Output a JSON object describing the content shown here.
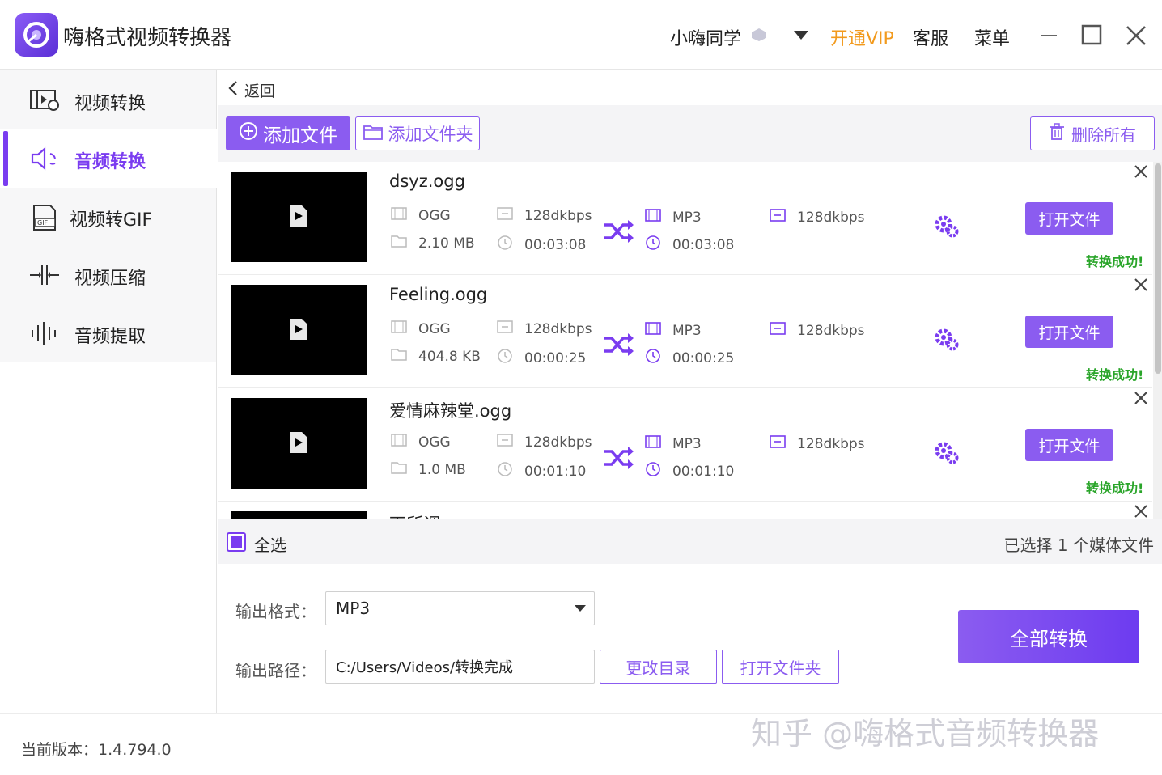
{
  "app": {
    "title": "嗨格式视频转换器"
  },
  "header": {
    "user_name": "小嗨同学",
    "vip": "开通VIP",
    "service": "客服",
    "menu": "菜单"
  },
  "sidebar": {
    "items": [
      {
        "label": "视频转换",
        "icon": "video-convert-icon",
        "active": false
      },
      {
        "label": "音频转换",
        "icon": "audio-convert-icon",
        "active": true
      },
      {
        "label": "视频转GIF",
        "icon": "gif-icon",
        "active": false
      },
      {
        "label": "视频压缩",
        "icon": "compress-icon",
        "active": false
      },
      {
        "label": "音频提取",
        "icon": "audio-extract-icon",
        "active": false
      }
    ],
    "version": "当前版本：1.4.794.0"
  },
  "main": {
    "back": "返回",
    "add_file": "添加文件",
    "add_folder": "添加文件夹",
    "delete_all": "删除所有",
    "files": [
      {
        "name": "dsyz.ogg",
        "src_format": "OGG",
        "src_bitrate": "128dkbps",
        "size": "2.10 MB",
        "src_duration": "00:03:08",
        "out_format": "MP3",
        "out_bitrate": "128dkbps",
        "out_duration": "00:03:08",
        "open": "打开文件",
        "status": "转换成功!"
      },
      {
        "name": "Feeling.ogg",
        "src_format": "OGG",
        "src_bitrate": "128dkbps",
        "size": "404.8 KB",
        "src_duration": "00:00:25",
        "out_format": "MP3",
        "out_bitrate": "128dkbps",
        "out_duration": "00:00:25",
        "open": "打开文件",
        "status": "转换成功!"
      },
      {
        "name": "爱情麻辣堂.ogg",
        "src_format": "OGG",
        "src_bitrate": "128dkbps",
        "size": "1.0 MB",
        "src_duration": "00:01:10",
        "out_format": "MP3",
        "out_bitrate": "128dkbps",
        "out_duration": "00:01:10",
        "open": "打开文件",
        "status": "转换成功!"
      },
      {
        "name": "下所调.ogg",
        "src_format": "",
        "src_bitrate": "",
        "size": "",
        "src_duration": "",
        "out_format": "",
        "out_bitrate": "",
        "out_duration": "",
        "open": "",
        "status": ""
      }
    ],
    "select_all": "全选",
    "selection_count": "已选择 1 个媒体文件",
    "output_format_label": "输出格式：",
    "output_format": "MP3",
    "output_path_label": "输出路径：",
    "output_path": "C:/Users/Videos/转换完成",
    "change_dir": "更改目录",
    "open_folder": "打开文件夹",
    "convert_all": "全部转换"
  },
  "watermark": "知乎 @嗨格式音频转换器",
  "colors": {
    "accent": "#8b5cf0",
    "vip": "#f29a1d",
    "success": "#2aa52a"
  }
}
